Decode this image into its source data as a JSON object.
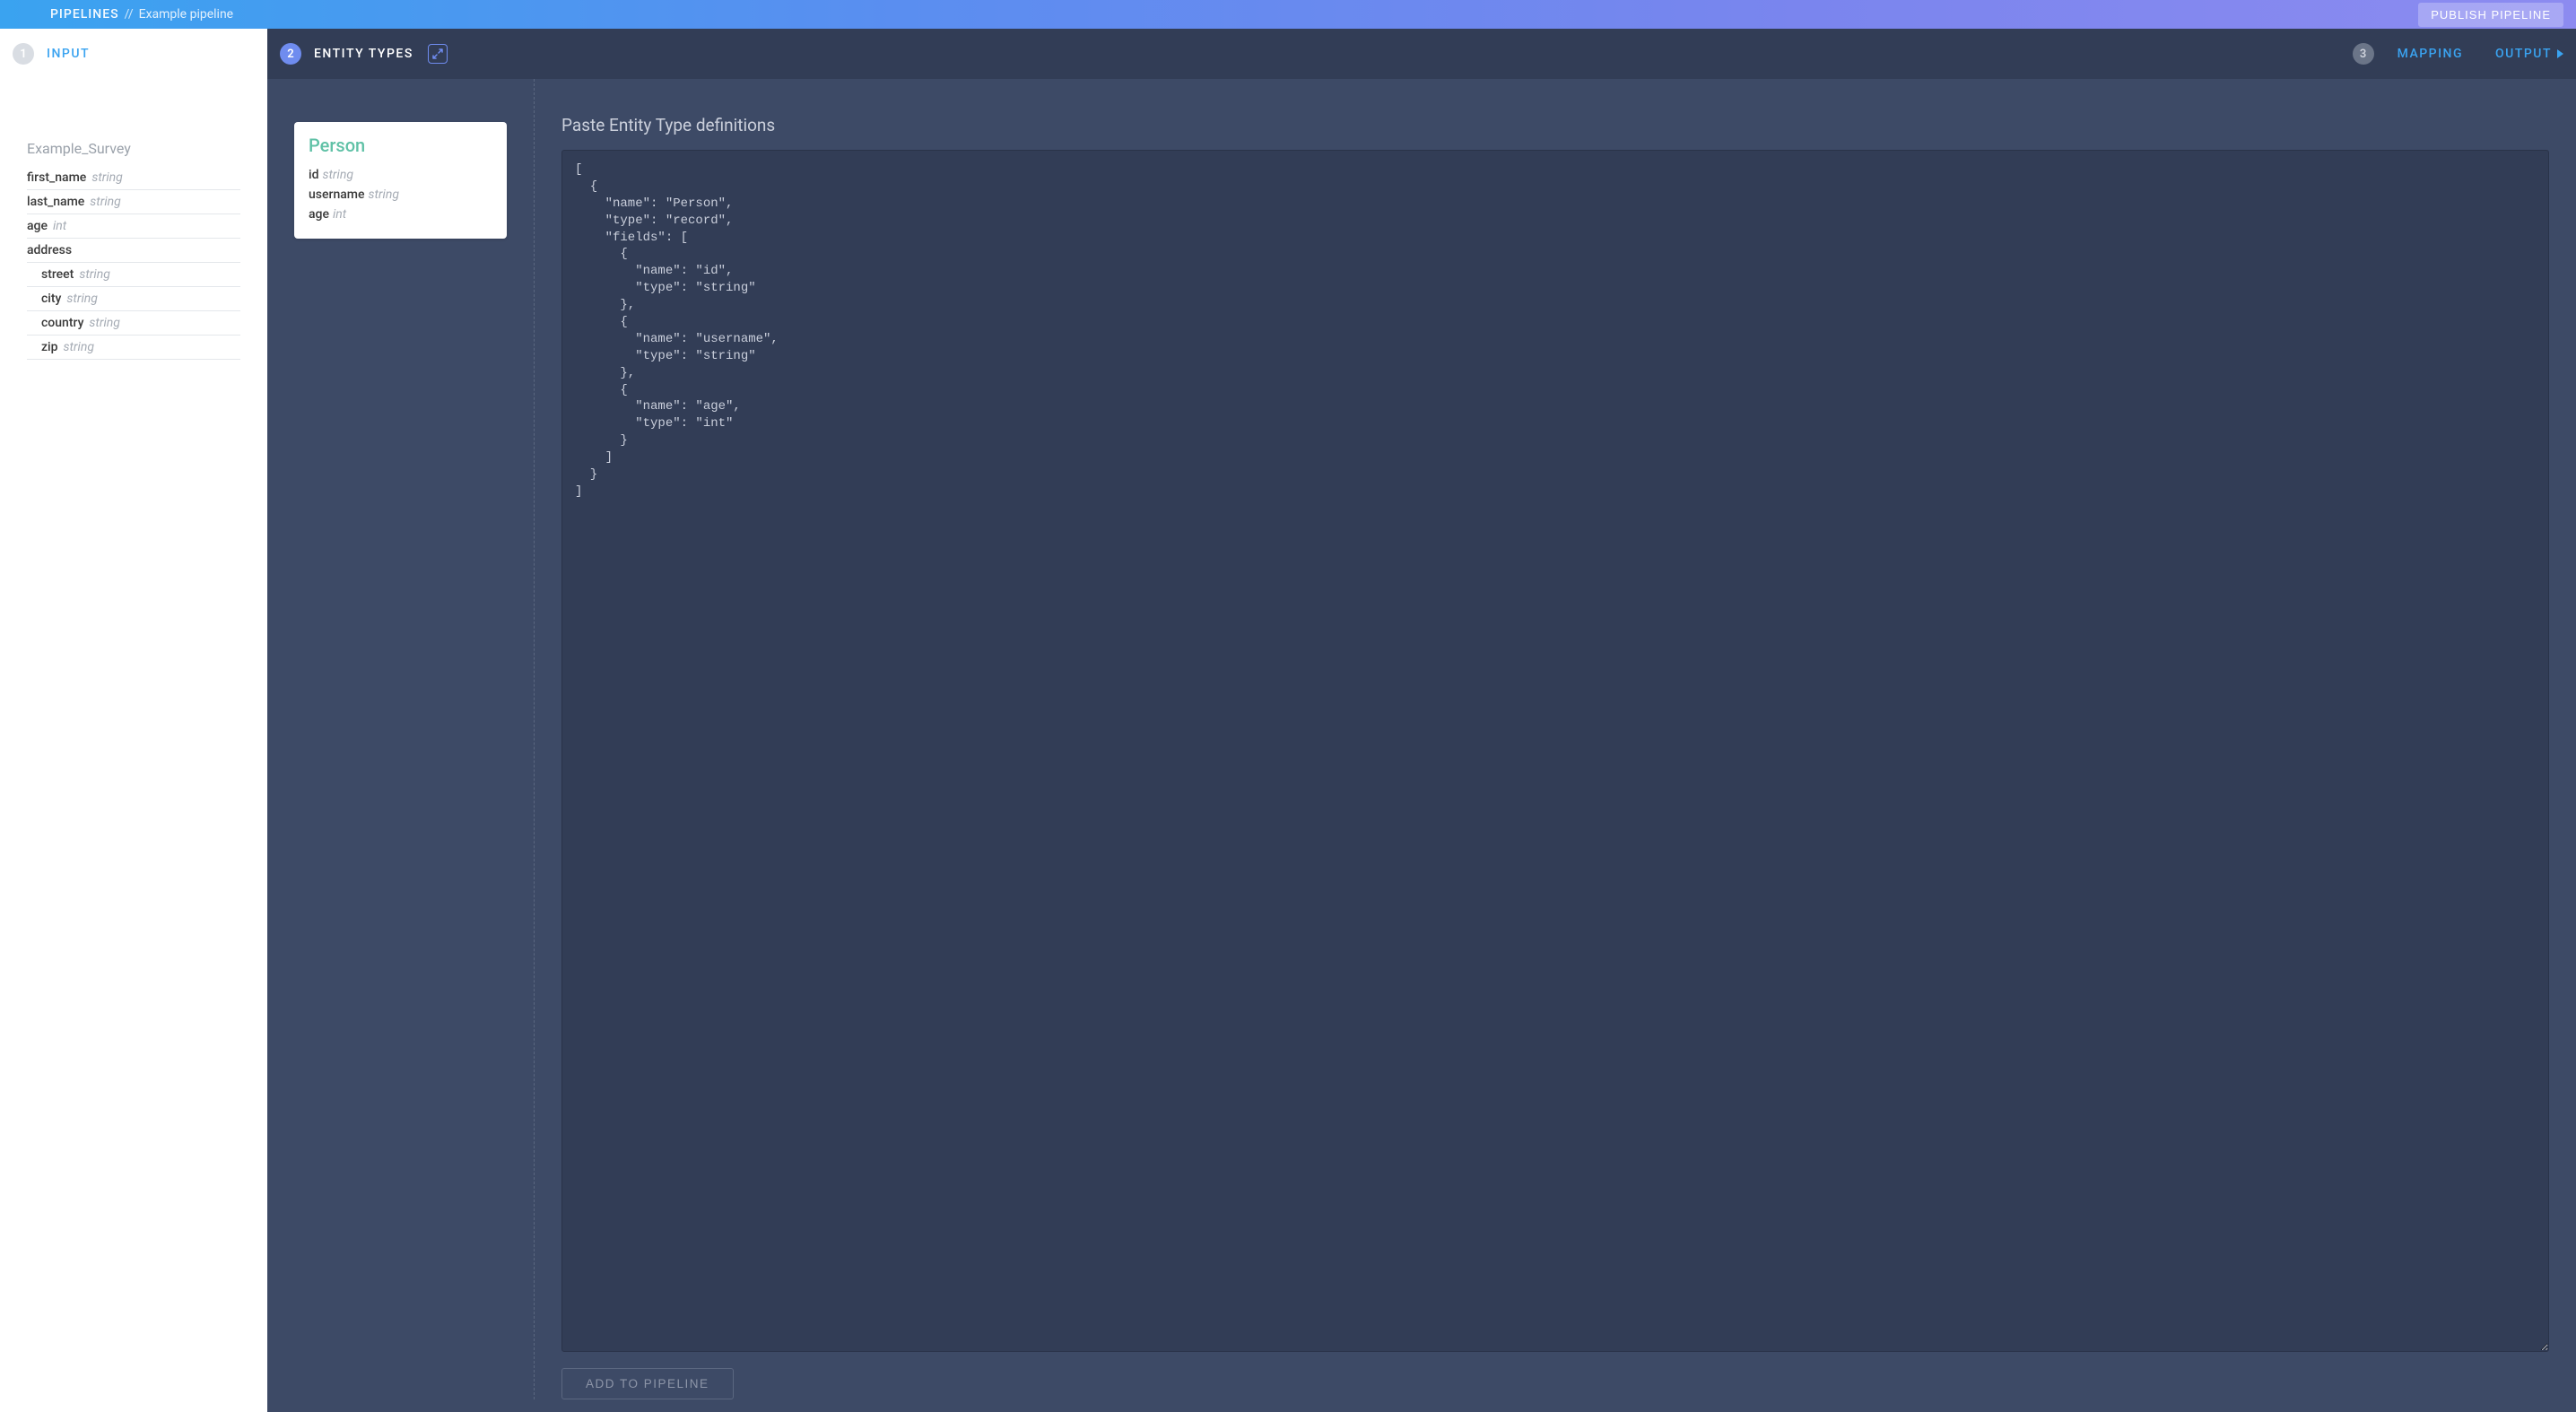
{
  "topbar": {
    "crumb_root": "PIPELINES",
    "crumb_sep": "//",
    "crumb_current": "Example pipeline",
    "publish_label": "PUBLISH PIPELINE"
  },
  "steps": {
    "input": {
      "num": "1",
      "label": "INPUT"
    },
    "entity_types": {
      "num": "2",
      "label": "ENTITY TYPES"
    },
    "mapping": {
      "num": "3",
      "label": "MAPPING"
    },
    "output": {
      "label": "OUTPUT"
    }
  },
  "input_schema": {
    "title": "Example_Survey",
    "fields": [
      {
        "name": "first_name",
        "type": "string",
        "indent": 0
      },
      {
        "name": "last_name",
        "type": "string",
        "indent": 0
      },
      {
        "name": "age",
        "type": "int",
        "indent": 0
      },
      {
        "name": "address",
        "type": "",
        "indent": 0
      },
      {
        "name": "street",
        "type": "string",
        "indent": 1
      },
      {
        "name": "city",
        "type": "string",
        "indent": 1
      },
      {
        "name": "country",
        "type": "string",
        "indent": 1
      },
      {
        "name": "zip",
        "type": "string",
        "indent": 1
      }
    ]
  },
  "entity_card": {
    "name": "Person",
    "fields": [
      {
        "name": "id",
        "type": "string"
      },
      {
        "name": "username",
        "type": "string"
      },
      {
        "name": "age",
        "type": "int"
      }
    ]
  },
  "defs": {
    "title": "Paste Entity Type definitions",
    "code": "[\n  {\n    \"name\": \"Person\",\n    \"type\": \"record\",\n    \"fields\": [\n      {\n        \"name\": \"id\",\n        \"type\": \"string\"\n      },\n      {\n        \"name\": \"username\",\n        \"type\": \"string\"\n      },\n      {\n        \"name\": \"age\",\n        \"type\": \"int\"\n      }\n    ]\n  }\n]",
    "add_label": "ADD TO PIPELINE"
  }
}
